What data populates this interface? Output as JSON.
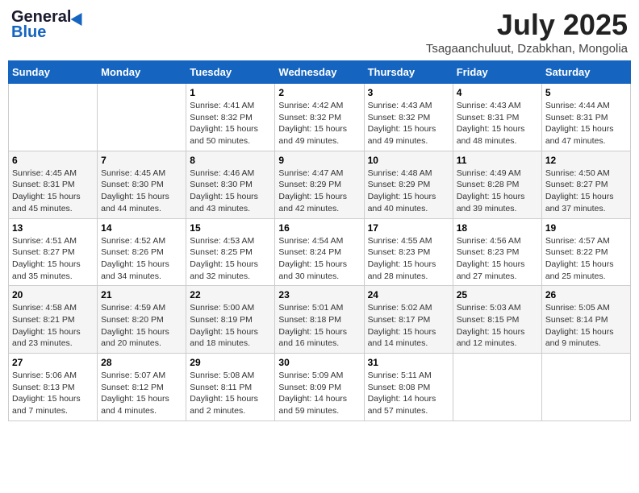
{
  "header": {
    "logo_general": "General",
    "logo_blue": "Blue",
    "month": "July 2025",
    "location": "Tsagaanchuluut, Dzabkhan, Mongolia"
  },
  "days_of_week": [
    "Sunday",
    "Monday",
    "Tuesday",
    "Wednesday",
    "Thursday",
    "Friday",
    "Saturday"
  ],
  "weeks": [
    [
      {
        "day": "",
        "info": ""
      },
      {
        "day": "",
        "info": ""
      },
      {
        "day": "1",
        "info": "Sunrise: 4:41 AM\nSunset: 8:32 PM\nDaylight: 15 hours\nand 50 minutes."
      },
      {
        "day": "2",
        "info": "Sunrise: 4:42 AM\nSunset: 8:32 PM\nDaylight: 15 hours\nand 49 minutes."
      },
      {
        "day": "3",
        "info": "Sunrise: 4:43 AM\nSunset: 8:32 PM\nDaylight: 15 hours\nand 49 minutes."
      },
      {
        "day": "4",
        "info": "Sunrise: 4:43 AM\nSunset: 8:31 PM\nDaylight: 15 hours\nand 48 minutes."
      },
      {
        "day": "5",
        "info": "Sunrise: 4:44 AM\nSunset: 8:31 PM\nDaylight: 15 hours\nand 47 minutes."
      }
    ],
    [
      {
        "day": "6",
        "info": "Sunrise: 4:45 AM\nSunset: 8:31 PM\nDaylight: 15 hours\nand 45 minutes."
      },
      {
        "day": "7",
        "info": "Sunrise: 4:45 AM\nSunset: 8:30 PM\nDaylight: 15 hours\nand 44 minutes."
      },
      {
        "day": "8",
        "info": "Sunrise: 4:46 AM\nSunset: 8:30 PM\nDaylight: 15 hours\nand 43 minutes."
      },
      {
        "day": "9",
        "info": "Sunrise: 4:47 AM\nSunset: 8:29 PM\nDaylight: 15 hours\nand 42 minutes."
      },
      {
        "day": "10",
        "info": "Sunrise: 4:48 AM\nSunset: 8:29 PM\nDaylight: 15 hours\nand 40 minutes."
      },
      {
        "day": "11",
        "info": "Sunrise: 4:49 AM\nSunset: 8:28 PM\nDaylight: 15 hours\nand 39 minutes."
      },
      {
        "day": "12",
        "info": "Sunrise: 4:50 AM\nSunset: 8:27 PM\nDaylight: 15 hours\nand 37 minutes."
      }
    ],
    [
      {
        "day": "13",
        "info": "Sunrise: 4:51 AM\nSunset: 8:27 PM\nDaylight: 15 hours\nand 35 minutes."
      },
      {
        "day": "14",
        "info": "Sunrise: 4:52 AM\nSunset: 8:26 PM\nDaylight: 15 hours\nand 34 minutes."
      },
      {
        "day": "15",
        "info": "Sunrise: 4:53 AM\nSunset: 8:25 PM\nDaylight: 15 hours\nand 32 minutes."
      },
      {
        "day": "16",
        "info": "Sunrise: 4:54 AM\nSunset: 8:24 PM\nDaylight: 15 hours\nand 30 minutes."
      },
      {
        "day": "17",
        "info": "Sunrise: 4:55 AM\nSunset: 8:23 PM\nDaylight: 15 hours\nand 28 minutes."
      },
      {
        "day": "18",
        "info": "Sunrise: 4:56 AM\nSunset: 8:23 PM\nDaylight: 15 hours\nand 27 minutes."
      },
      {
        "day": "19",
        "info": "Sunrise: 4:57 AM\nSunset: 8:22 PM\nDaylight: 15 hours\nand 25 minutes."
      }
    ],
    [
      {
        "day": "20",
        "info": "Sunrise: 4:58 AM\nSunset: 8:21 PM\nDaylight: 15 hours\nand 23 minutes."
      },
      {
        "day": "21",
        "info": "Sunrise: 4:59 AM\nSunset: 8:20 PM\nDaylight: 15 hours\nand 20 minutes."
      },
      {
        "day": "22",
        "info": "Sunrise: 5:00 AM\nSunset: 8:19 PM\nDaylight: 15 hours\nand 18 minutes."
      },
      {
        "day": "23",
        "info": "Sunrise: 5:01 AM\nSunset: 8:18 PM\nDaylight: 15 hours\nand 16 minutes."
      },
      {
        "day": "24",
        "info": "Sunrise: 5:02 AM\nSunset: 8:17 PM\nDaylight: 15 hours\nand 14 minutes."
      },
      {
        "day": "25",
        "info": "Sunrise: 5:03 AM\nSunset: 8:15 PM\nDaylight: 15 hours\nand 12 minutes."
      },
      {
        "day": "26",
        "info": "Sunrise: 5:05 AM\nSunset: 8:14 PM\nDaylight: 15 hours\nand 9 minutes."
      }
    ],
    [
      {
        "day": "27",
        "info": "Sunrise: 5:06 AM\nSunset: 8:13 PM\nDaylight: 15 hours\nand 7 minutes."
      },
      {
        "day": "28",
        "info": "Sunrise: 5:07 AM\nSunset: 8:12 PM\nDaylight: 15 hours\nand 4 minutes."
      },
      {
        "day": "29",
        "info": "Sunrise: 5:08 AM\nSunset: 8:11 PM\nDaylight: 15 hours\nand 2 minutes."
      },
      {
        "day": "30",
        "info": "Sunrise: 5:09 AM\nSunset: 8:09 PM\nDaylight: 14 hours\nand 59 minutes."
      },
      {
        "day": "31",
        "info": "Sunrise: 5:11 AM\nSunset: 8:08 PM\nDaylight: 14 hours\nand 57 minutes."
      },
      {
        "day": "",
        "info": ""
      },
      {
        "day": "",
        "info": ""
      }
    ]
  ]
}
